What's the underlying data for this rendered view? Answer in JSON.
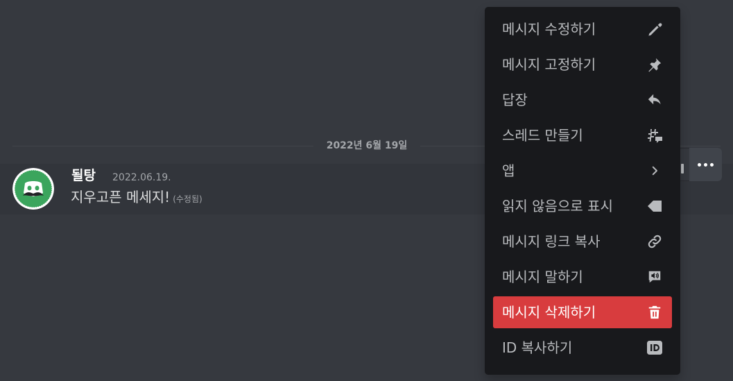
{
  "divider": {
    "date_label": "2022년 6월 19일"
  },
  "message": {
    "author": "될탕",
    "timestamp": "2022.06.19.",
    "text": "지우고픈 메세지!",
    "edited_label": "(수정됨)"
  },
  "colors": {
    "background": "#36393f",
    "menu_background": "#18191c",
    "danger": "#d83c3e",
    "avatar_green": "#3ba55d"
  },
  "context_menu": {
    "items": [
      {
        "label": "메시지 수정하기",
        "icon": "pencil-icon"
      },
      {
        "label": "메시지 고정하기",
        "icon": "pin-icon"
      },
      {
        "label": "답장",
        "icon": "reply-icon"
      },
      {
        "label": "스레드 만들기",
        "icon": "thread-icon"
      },
      {
        "label": "앱",
        "icon": "chevron-right-icon"
      },
      {
        "label": "읽지 않음으로 표시",
        "icon": "mark-unread-icon"
      },
      {
        "label": "메시지 링크 복사",
        "icon": "link-icon"
      },
      {
        "label": "메시지 말하기",
        "icon": "speak-message-icon"
      },
      {
        "label": "메시지 삭제하기",
        "icon": "trash-icon",
        "danger": true
      },
      {
        "label": "ID 복사하기",
        "icon": "id-icon"
      }
    ]
  },
  "toolbar": {
    "more_icon": "more-dots-icon"
  }
}
